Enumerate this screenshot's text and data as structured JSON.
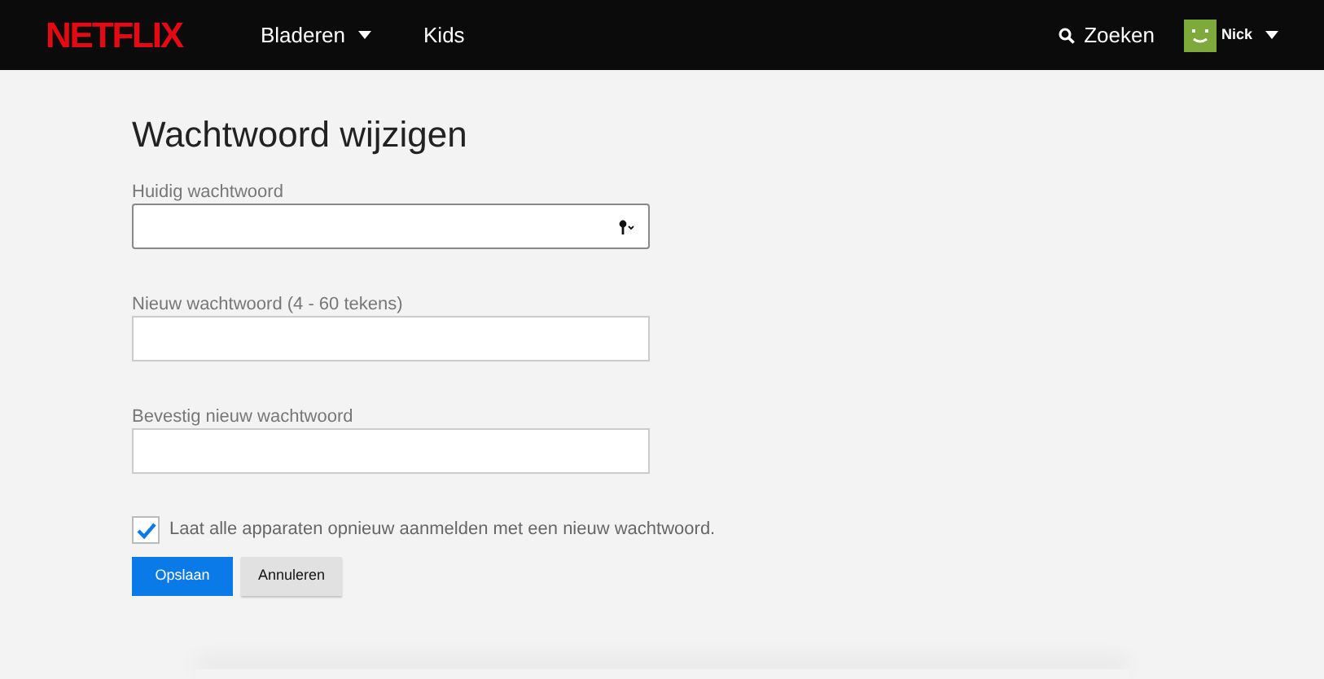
{
  "header": {
    "logo": "NETFLIX",
    "nav": [
      {
        "label": "Bladeren",
        "dropdown": true
      },
      {
        "label": "Kids",
        "dropdown": false
      }
    ],
    "search": "Zoeken",
    "profile": {
      "name": "Nick"
    }
  },
  "title": "Wachtwoord wijzigen",
  "fields": [
    {
      "label": "Huidig wachtwoord",
      "kind": "keychain"
    },
    {
      "label": "Nieuw wachtwoord (4 - 60 tekens)",
      "kind": "plain"
    },
    {
      "label": "Bevestig nieuw wachtwoord",
      "kind": "plain"
    }
  ],
  "signout_all": {
    "label": "Laat alle apparaten opnieuw aanmelden met een nieuw wachtwoord.",
    "checked": true
  },
  "buttons": [
    {
      "label": "Opslaan",
      "kind": "primary"
    },
    {
      "label": "Annuleren",
      "kind": "secondary"
    }
  ]
}
